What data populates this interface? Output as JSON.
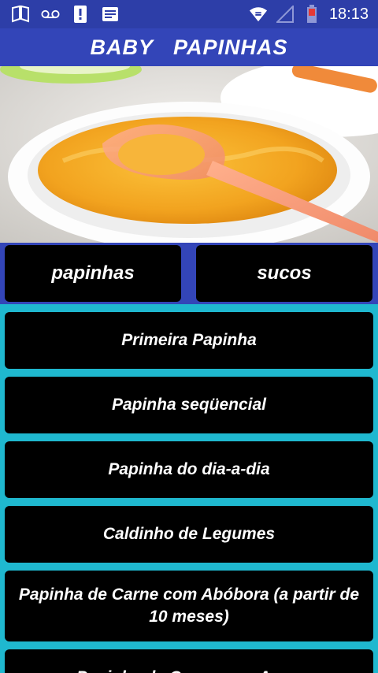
{
  "status_bar": {
    "time": "18:13",
    "icons": [
      "book-icon",
      "voicemail-icon",
      "alert-icon",
      "news-icon",
      "wifi-icon",
      "signal-icon",
      "battery-icon"
    ]
  },
  "app_bar": {
    "title": "BABY   PAPINHAS"
  },
  "colors": {
    "status_bar": "#2d3ea8",
    "app_bar": "#3345b8",
    "list_background": "#1fb8cf",
    "button": "#000000",
    "text": "#ffffff"
  },
  "tabs": [
    {
      "label": "papinhas"
    },
    {
      "label": "sucos"
    }
  ],
  "recipes": [
    {
      "label": "Primeira Papinha"
    },
    {
      "label": "Papinha seqüencial"
    },
    {
      "label": "Papinha do dia-a-dia"
    },
    {
      "label": "Caldinho de Legumes"
    },
    {
      "label": "Papinha de Carne com Abóbora (a partir de 10 meses)"
    },
    {
      "label": "Papinha de Carne com Arroz"
    }
  ]
}
